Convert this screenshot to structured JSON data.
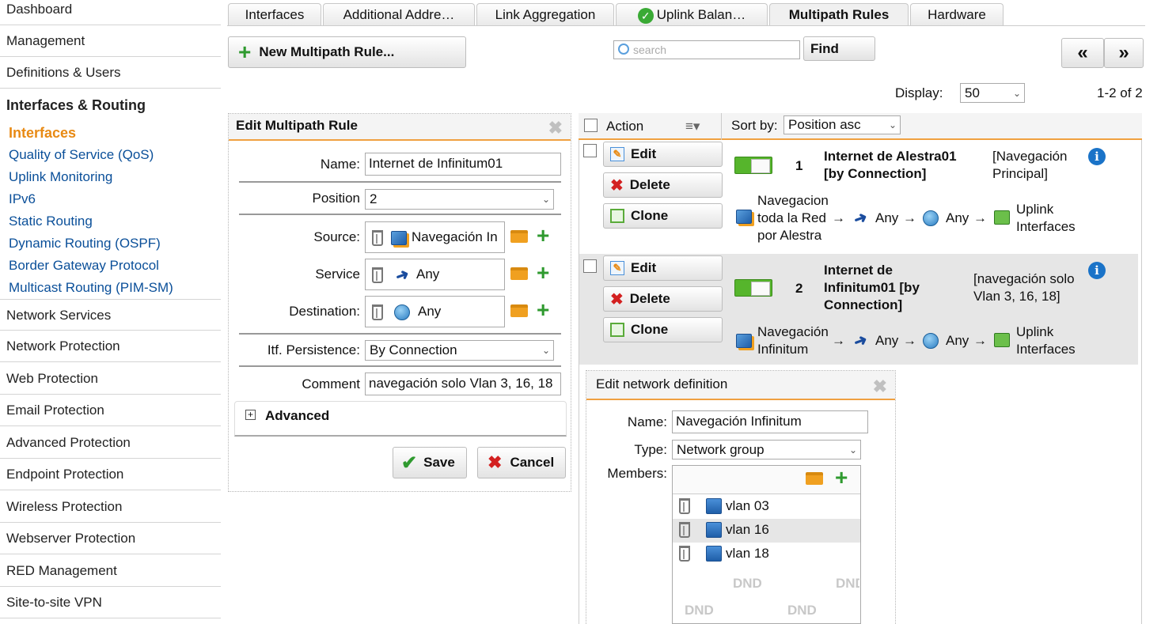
{
  "sidebar": {
    "top_items": [
      "Dashboard",
      "Management",
      "Definitions & Users",
      "Interfaces & Routing"
    ],
    "sub_items": [
      "Interfaces",
      "Quality of Service (QoS)",
      "Uplink Monitoring",
      "IPv6",
      "Static Routing",
      "Dynamic Routing (OSPF)",
      "Border Gateway Protocol",
      "Multicast Routing (PIM-SM)"
    ],
    "bottom_items": [
      "Network Services",
      "Network Protection",
      "Web Protection",
      "Email Protection",
      "Advanced Protection",
      "Endpoint Protection",
      "Wireless Protection",
      "Webserver Protection",
      "RED Management",
      "Site-to-site VPN"
    ]
  },
  "tabs": [
    "Interfaces",
    "Additional Addre…",
    "Link Aggregation",
    "Uplink Balan…",
    "Multipath Rules",
    "Hardware"
  ],
  "toolbar": {
    "new_rule": "New Multipath Rule...",
    "search_placeholder": "search",
    "find": "Find",
    "prev": "«",
    "next": "»",
    "display_label": "Display:",
    "display_value": "50",
    "count": "1-2 of 2"
  },
  "edit_rule": {
    "title": "Edit Multipath Rule",
    "name_label": "Name:",
    "name_value": "Internet de Infinitum01",
    "position_label": "Position",
    "position_value": "2",
    "source_label": "Source:",
    "source_value": "Navegación In",
    "service_label": "Service",
    "service_value": "Any",
    "destination_label": "Destination:",
    "destination_value": "Any",
    "persistence_label": "Itf. Persistence:",
    "persistence_value": "By Connection",
    "comment_label": "Comment",
    "comment_value": "navegación solo Vlan 3, 16, 18",
    "advanced": "Advanced",
    "save": "Save",
    "cancel": "Cancel"
  },
  "list": {
    "action_label": "Action",
    "sortby_label": "Sort by:",
    "sortby_value": "Position asc",
    "edit": "Edit",
    "delete": "Delete",
    "clone": "Clone",
    "rows": [
      {
        "pos": "1",
        "title1": "Internet de Alestra01",
        "title2": "[by Connection]",
        "comment1": "[Navegación",
        "comment2": "Principal]",
        "src1": "Navegacion",
        "src2": "toda la Red",
        "src3": "por Alestra",
        "service": "Any",
        "dest": "Any",
        "iface1": "Uplink",
        "iface2": "Interfaces"
      },
      {
        "pos": "2",
        "title1": "Internet de",
        "title2": "Infinitum01 [by",
        "title3": "Connection]",
        "comment1": "[navegación solo",
        "comment2": "Vlan 3, 16, 18]",
        "src1": "Navegación",
        "src2": "Infinitum",
        "service": "Any",
        "dest": "Any",
        "iface1": "Uplink",
        "iface2": "Interfaces"
      }
    ]
  },
  "edit_network": {
    "title": "Edit network definition",
    "name_label": "Name:",
    "name_value": "Navegación Infinitum",
    "type_label": "Type:",
    "type_value": "Network group",
    "members_label": "Members:",
    "members": [
      "vlan 03",
      "vlan 16",
      "vlan 18"
    ],
    "dnd": "DND"
  }
}
